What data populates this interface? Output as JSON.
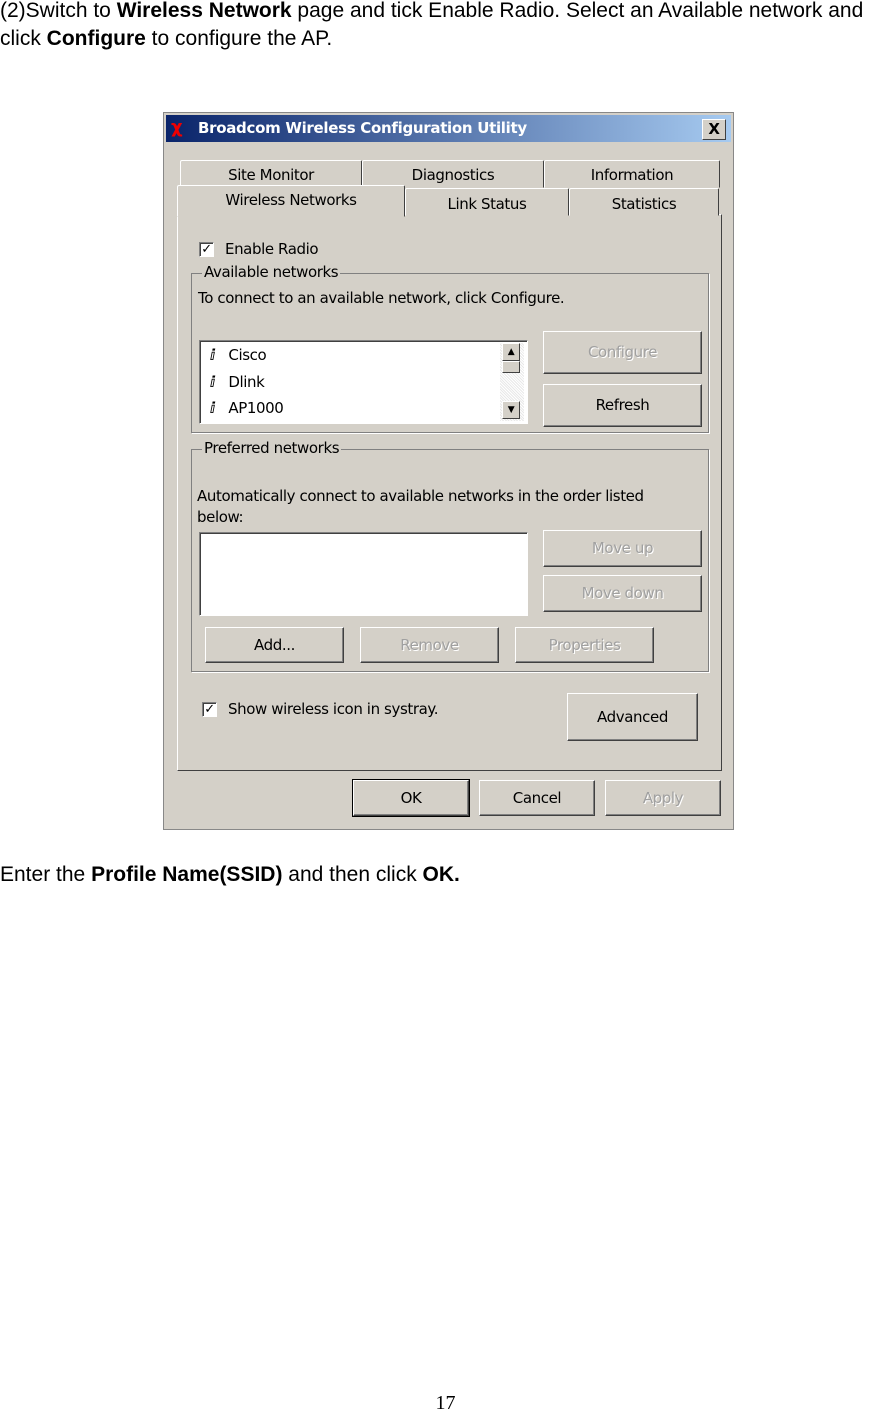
{
  "doc": {
    "intro_1": "(2)Switch to ",
    "intro_bold_1": "Wireless Network",
    "intro_2": " page and tick Enable Radio. Select  an Available network and click ",
    "intro_bold_2": "Configure",
    "intro_3": " to configure the AP.",
    "outro_1": "Enter the ",
    "outro_bold_1": "Profile Name(SSID)",
    "outro_2": " and then click ",
    "outro_bold_2": "OK.",
    "page_number": "17"
  },
  "dialog": {
    "title": "Broadcom Wireless Configuration Utility",
    "close_label": "X",
    "tabs_back": [
      "Site Monitor",
      "Diagnostics",
      "Information"
    ],
    "tabs_front": [
      "Wireless Networks",
      "Link Status",
      "Statistics"
    ],
    "active_tab": "Wireless Networks",
    "enable_radio": {
      "label": "Enable Radio",
      "checked": true
    },
    "available": {
      "legend": "Available networks",
      "hint": "To connect to an available network, click Configure.",
      "networks": [
        "Cisco",
        "Dlink",
        "AP1000"
      ],
      "configure": "Configure",
      "refresh": "Refresh"
    },
    "preferred": {
      "legend": "Preferred networks",
      "hint": "Automatically connect to available networks in the order listed below:",
      "move_up": "Move up",
      "move_down": "Move down",
      "add": "Add...",
      "remove": "Remove",
      "properties": "Properties"
    },
    "systray": {
      "label": "Show wireless icon in systray.",
      "checked": true
    },
    "advanced": "Advanced",
    "ok": "OK",
    "cancel": "Cancel",
    "apply": "Apply",
    "title_bar_color": "#0a246a",
    "face_color": "#d4d0c8"
  }
}
